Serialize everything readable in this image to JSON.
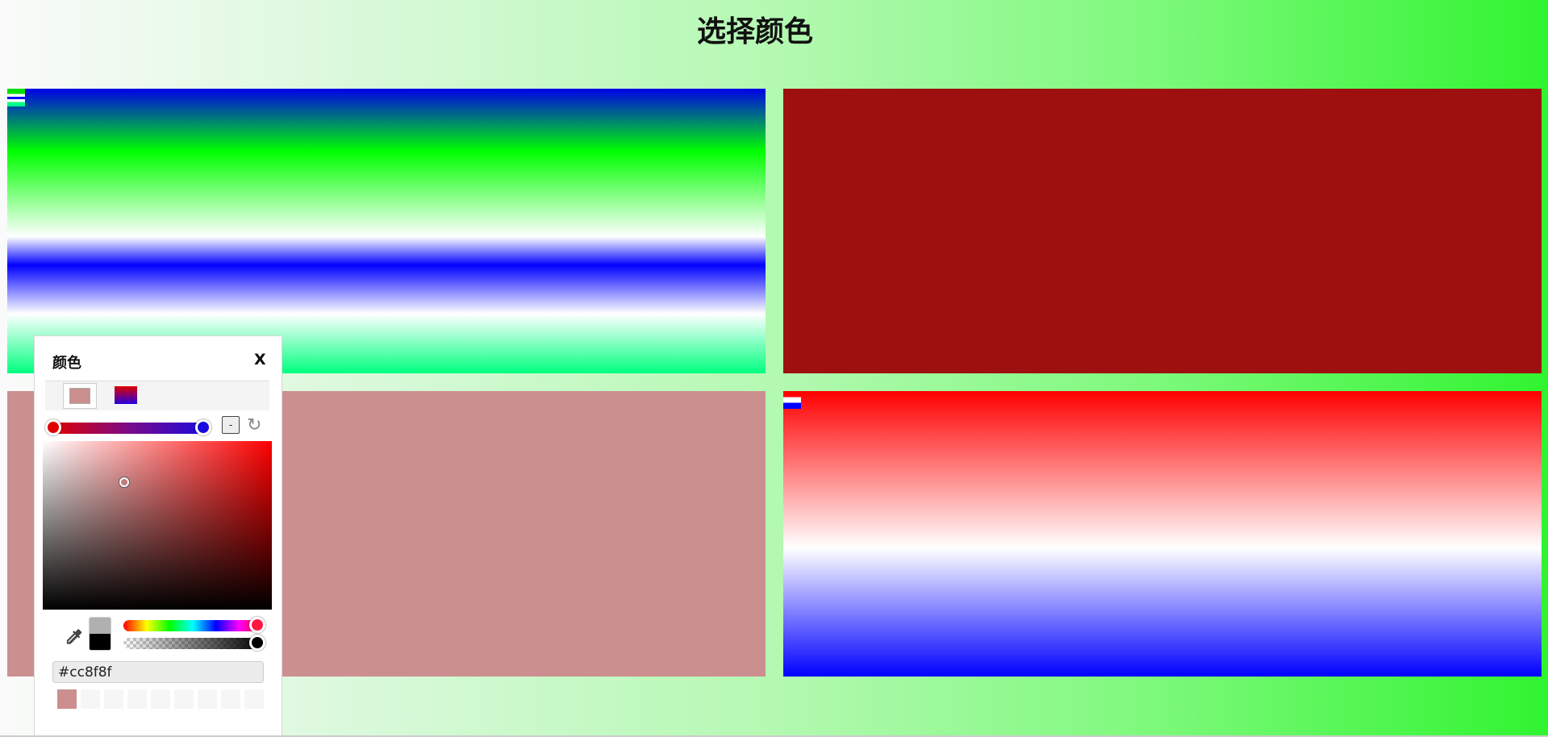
{
  "page": {
    "title": "选择颜色"
  },
  "panels": [
    {
      "name": "gradient-green-blue",
      "fill": "linear-gradient"
    },
    {
      "name": "solid-dark-red",
      "fill": "#9e0f0f"
    },
    {
      "name": "solid-pink",
      "fill": "#cc8f8f"
    },
    {
      "name": "gradient-red-blue",
      "fill": "linear-gradient"
    }
  ],
  "picker": {
    "title": "颜色",
    "close_label": "X",
    "minus_label": "-",
    "hex_value": "#cc8f8f",
    "current_color": "#cc8f8f",
    "gradient_stops": [
      "#e00000",
      "#1a0ae0"
    ],
    "history": [
      "#cc8f8f",
      "",
      "",
      "",
      "",
      "",
      "",
      "",
      ""
    ]
  },
  "colors": {
    "dark_red": "#9e0f0f",
    "pink": "#cc8f8f"
  }
}
